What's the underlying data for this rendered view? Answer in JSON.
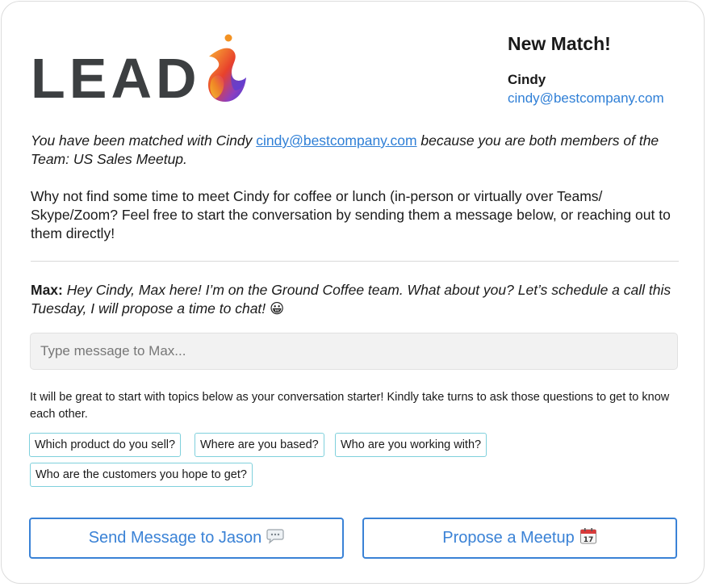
{
  "logo": {
    "text": "LEAD"
  },
  "header": {
    "title": "New Match!",
    "match_name": "Cindy",
    "match_email": "cindy@bestcompany.com"
  },
  "intro": {
    "line1_prefix": "You have been matched with Cindy ",
    "line1_email": "cindy@bestcompany.com",
    "line1_suffix": " because you are both members of the Team: US Sales Meetup.",
    "paragraph2": "Why not find some time to meet Cindy for coffee or lunch (in-person or virtually over Teams/ Skype/Zoom? Feel free to start the conversation by sending them a message below, or reaching out to them directly!"
  },
  "message": {
    "sender": "Max:",
    "text": "Hey Cindy, Max here! I’m on the Ground Coffee team. What about you? Let’s schedule a call this Tuesday, I will propose a time to chat! 😀"
  },
  "composer": {
    "placeholder": "Type message to Max..."
  },
  "hint": "It will be great to start with topics below as your conversation starter! Kindly take turns to ask those questions to get to know each other.",
  "topics": [
    "Which product do you sell?",
    "Where are you based?",
    "Who are you working with?",
    "Who are the customers you hope to get?"
  ],
  "actions": {
    "send_label": "Send Message to Jason",
    "send_icon": "speech-bubble-icon",
    "propose_label": "Propose a Meetup",
    "propose_icon": "calendar-icon"
  },
  "colors": {
    "accent": "#3a82d6",
    "link": "#2f7fd6",
    "chip_border": "#7fd0dc",
    "logo_text": "#3c3f41"
  }
}
